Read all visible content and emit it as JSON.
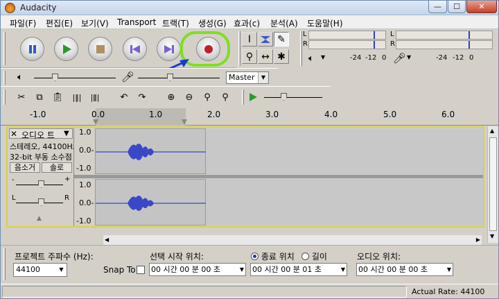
{
  "window": {
    "title": "Audacity"
  },
  "menu": [
    "파일(F)",
    "편집(E)",
    "보기(V)",
    "Transport",
    "트랙(T)",
    "생성(G)",
    "효과(c)",
    "분석(A)",
    "도움말(H)"
  ],
  "meters": {
    "left": "L",
    "right": "R",
    "scale": [
      "-24",
      "-12",
      "0",
      "-24",
      "-12",
      "0"
    ]
  },
  "mixer": {
    "input_source": "Master"
  },
  "ruler": {
    "labels": [
      "-1.0",
      "0.0",
      "1.0",
      "2.0",
      "3.0",
      "4.0",
      "5.0",
      "6.0"
    ]
  },
  "track": {
    "name": "오디오 트",
    "info_line1": "스테레오, 44100Hz",
    "info_line2": "32-bit 부동 소수점",
    "mute_label": "음소거",
    "solo_label": "솔로",
    "pan_left": "L",
    "pan_right": "R",
    "gain_minus": "-",
    "gain_plus": "+",
    "scale": [
      "1.0",
      "0.0-",
      "-1.0",
      "1.0",
      "0.0-",
      "-1.0"
    ]
  },
  "selection": {
    "rate_label": "프로젝트 주파수 (Hz):",
    "rate_value": "44100",
    "snap_label": "Snap To",
    "start_label": "선택 시작 위치:",
    "end_label": "종료 위치",
    "length_label": "길이",
    "audio_pos_label": "오디오 위치:",
    "start_value": "00 시간 00 분 00 초",
    "end_value": "00 시간 00 분 01 초",
    "audio_pos_value": "00 시간 00 분 00 초"
  },
  "status": {
    "actual_rate": "Actual Rate: 44100"
  },
  "colors": {
    "pause": "#2a5fc4",
    "play": "#2a9a2a",
    "stop": "#b09060",
    "skip": "#7a5fd0",
    "record": "#c0202a",
    "highlight": "#7de01e",
    "arrow": "#1a3ad0",
    "wave": "#3a48c8"
  }
}
